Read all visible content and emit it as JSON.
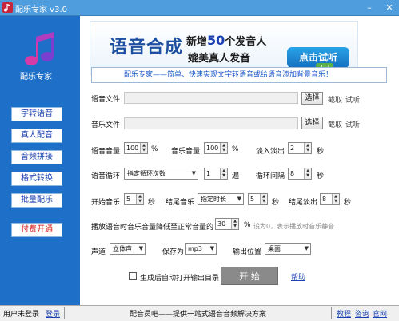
{
  "window": {
    "title": "配乐专家 v3.0",
    "minimize": "–",
    "close": "✕"
  },
  "sidebar": {
    "brand": "配乐专家",
    "items": [
      {
        "label": "字转语音"
      },
      {
        "label": "真人配音"
      },
      {
        "label": "音频拼接"
      },
      {
        "label": "格式转换"
      },
      {
        "label": "批量配乐"
      },
      {
        "label": "付费开通"
      }
    ]
  },
  "banner": {
    "title": "语音合成",
    "line1_prefix": "新增",
    "line1_number": "50",
    "line1_suffix": "个发音人",
    "line2": "媲美真人发音",
    "try_button": "点击试听",
    "badge": "1 2"
  },
  "tagline": "配乐专家——简单、快速实现文字转语音或给语音添加背景音乐！",
  "voice_file": {
    "label": "语音文件",
    "value": "",
    "select": "选择",
    "clip": "截取",
    "listen": "试听"
  },
  "music_file": {
    "label": "音乐文件",
    "value": "",
    "select": "选择",
    "clip": "截取",
    "listen": "试听"
  },
  "volume": {
    "voice_label": "语音音量",
    "voice_value": "100",
    "voice_unit": "%",
    "music_label": "音乐音量",
    "music_value": "100",
    "music_unit": "%",
    "fade_label": "淡入淡出",
    "fade_value": "2",
    "fade_unit": "秒"
  },
  "loop": {
    "label": "语音循环",
    "mode": "指定循环次数",
    "count": "1",
    "count_unit": "遍",
    "interval_label": "循环间隔",
    "interval_value": "8",
    "interval_unit": "秒"
  },
  "timing": {
    "start_label": "开始音乐",
    "start_value": "5",
    "start_unit": "秒",
    "end_label": "结尾音乐",
    "end_mode": "指定时长",
    "end_value": "5",
    "end_unit": "秒",
    "tail_label": "结尾淡出",
    "tail_value": "8",
    "tail_unit": "秒"
  },
  "duck": {
    "label": "播放语音时音乐音量降低至正常音量的",
    "value": "30",
    "unit": "%",
    "hint": "设为0，表示播放时音乐静音"
  },
  "output": {
    "channel_label": "声道",
    "channel_value": "立体声",
    "format_label": "保存为",
    "format_value": "mp3",
    "location_label": "输出位置",
    "location_value": "桌面"
  },
  "auto_open": {
    "checked": false,
    "label": "生成后自动打开输出目录"
  },
  "start_button": "开 始",
  "help_link": "帮助",
  "statusbar": {
    "user": "用户未登录",
    "login": "登录",
    "slogan": "配音员吧——提供一站式语音音频解决方案",
    "tutorial": "教程",
    "consult": "咨询",
    "website": "官网"
  },
  "colors": {
    "sidebar": "#1e6fc7",
    "titlebar": "#4f9ddc",
    "nav_text": "#1a3fb0",
    "paid_text": "#d01010"
  }
}
